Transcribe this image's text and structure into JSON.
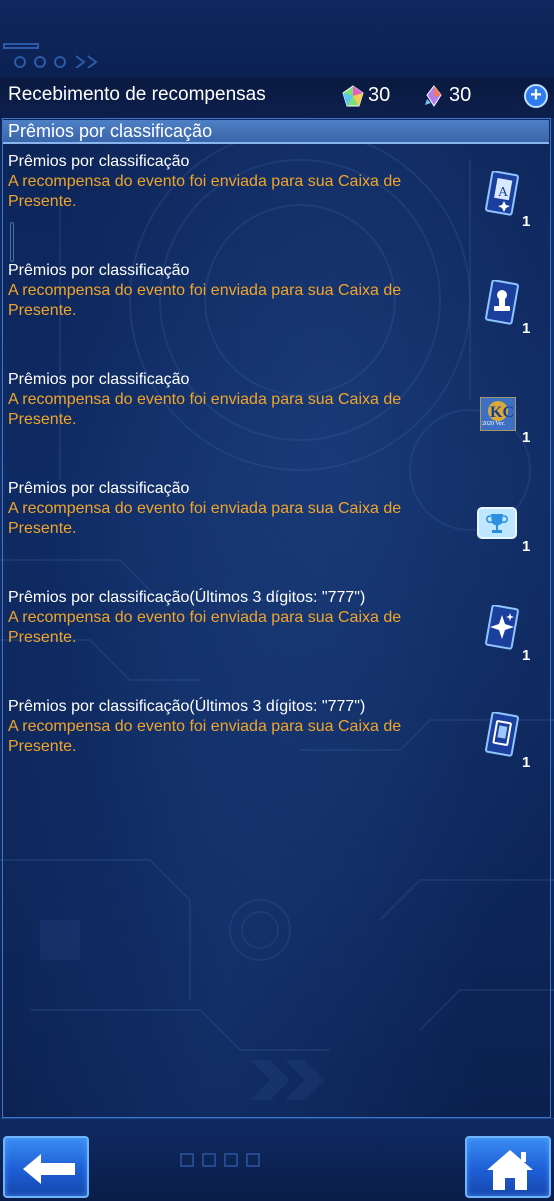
{
  "header": {
    "title": "Recebimento de recompensas",
    "currencies": [
      {
        "icon": "rainbow-gem-icon",
        "value": "30"
      },
      {
        "icon": "crystal-gem-icon",
        "value": "30"
      }
    ],
    "add_label": "+"
  },
  "section": {
    "title": "Prêmios por classificação"
  },
  "items": [
    {
      "name": "Prêmios por classificação",
      "desc": "A recompensa do evento foi enviada para sua Caixa de Presente.",
      "icon": "card-a-icon",
      "qty": "1"
    },
    {
      "name": "Prêmios por classificação",
      "desc": "A recompensa do evento foi enviada para sua Caixa de Presente.",
      "icon": "card-stamp-icon",
      "qty": "1"
    },
    {
      "name": "Prêmios por classificação",
      "desc": "A recompensa do evento foi enviada para sua Caixa de Presente.",
      "icon": "kc-2020-badge-icon",
      "qty": "1",
      "icon_text": "2020 Ver."
    },
    {
      "name": "Prêmios por classificação",
      "desc": "A recompensa do evento foi enviada para sua Caixa de Presente.",
      "icon": "trophy-frame-icon",
      "qty": "1"
    },
    {
      "name": "Prêmios por classificação(Últimos 3 dígitos: \"777\")",
      "desc": "A recompensa do evento foi enviada para sua Caixa de Presente.",
      "icon": "card-sparkle-icon",
      "qty": "1"
    },
    {
      "name": "Prêmios por classificação(Últimos 3 dígitos: \"777\")",
      "desc": "A recompensa do evento foi enviada para sua Caixa de Presente.",
      "icon": "card-sleeve-icon",
      "qty": "1"
    }
  ],
  "footer": {
    "back_icon": "back-arrow-icon",
    "home_icon": "home-icon"
  },
  "colors": {
    "accent_text": "#f0a52a",
    "button_blue": "#2a74e6",
    "panel_border": "#3e76c9"
  }
}
